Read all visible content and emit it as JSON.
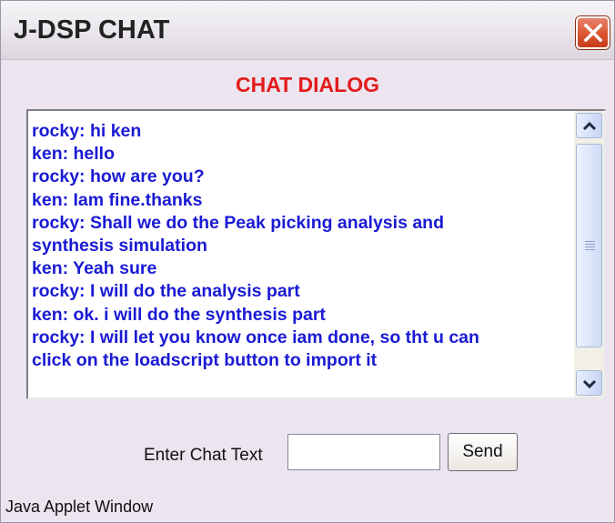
{
  "window": {
    "title": "J-DSP CHAT"
  },
  "dialog": {
    "heading": "CHAT DIALOG",
    "heading_color": "#e21b1b",
    "text_color": "#1a1ad4"
  },
  "chat": {
    "lines": [
      "rocky: hi ken",
      "ken:  hello",
      "rocky: how are you?",
      "ken:  Iam fine.thanks",
      "rocky: Shall we do the Peak picking analysis and",
      "synthesis simulation",
      "ken:  Yeah sure",
      "rocky: I will do the analysis part",
      "ken:  ok. i will do the synthesis part",
      "rocky: I will let you know once iam done, so tht u can",
      "click on the loadscript button to import it"
    ]
  },
  "input": {
    "label": "Enter Chat Text",
    "value": "",
    "send_label": "Send"
  },
  "status": {
    "text": "Java Applet Window"
  },
  "icons": {
    "close": "close-icon",
    "scroll_up": "chevron-up-icon",
    "scroll_down": "chevron-down-icon"
  }
}
